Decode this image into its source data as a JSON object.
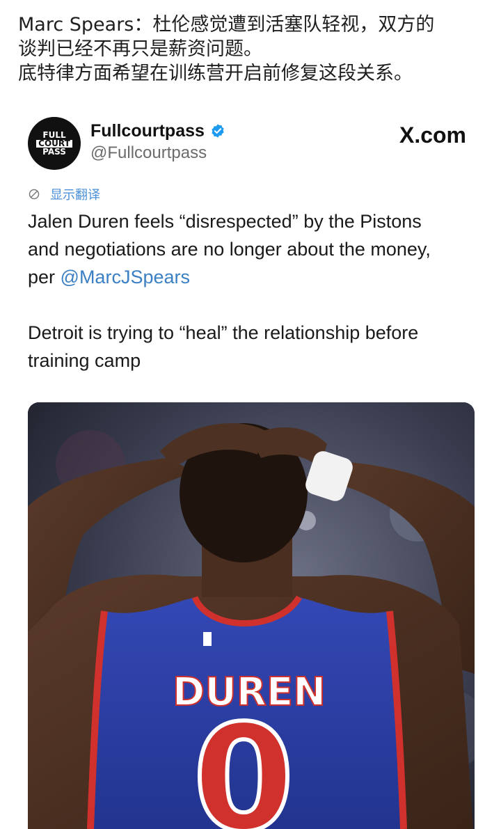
{
  "post": {
    "lines": [
      "Marc Spears：杜伦感觉遭到活塞队轻视，双方的",
      "谈判已经不再只是薪资问题。",
      "底特律方面希望在训练营开启前修复这段关系。"
    ]
  },
  "tweet": {
    "avatar_logo": [
      "FULL",
      "COURT",
      "PASS"
    ],
    "account_name": "Fullcourtpass",
    "handle": "@Fullcourtpass",
    "source": "X.com",
    "translate_label": "显示翻译",
    "body": {
      "line1": "Jalen Duren feels “disrespected” by the Pistons",
      "line2": "and negotiations are no longer about the money,",
      "line3_prefix": "per ",
      "mention": "@MarcJSpears",
      "line4": "Detroit is trying to “heal” the relationship before",
      "line5": "training camp"
    },
    "photo": {
      "jersey_name": "DUREN",
      "jersey_number": "0"
    }
  },
  "colors": {
    "mention": "#3b7fc4",
    "verified": "#1d9bf0",
    "jersey_blue": "#2b3fa8",
    "jersey_red": "#d0312d"
  },
  "icons": {
    "verified": "verified-badge-icon",
    "translate": "translate-globe-icon"
  }
}
